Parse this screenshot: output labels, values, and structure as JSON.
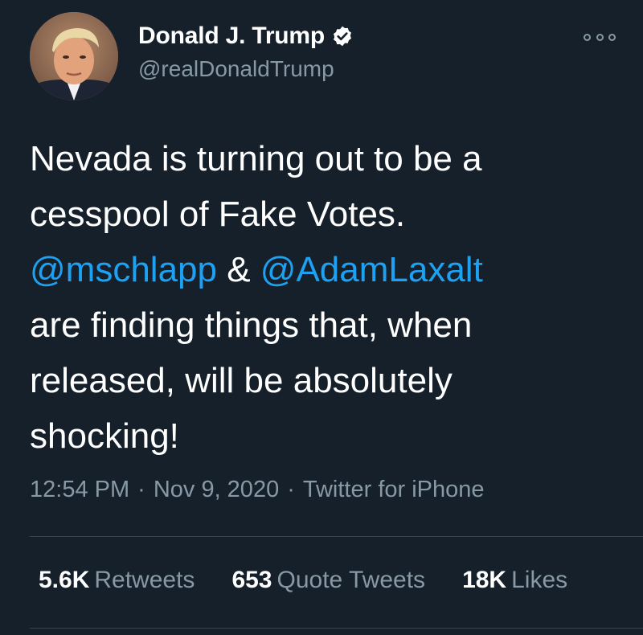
{
  "author": {
    "display_name": "Donald J. Trump",
    "handle": "@realDonaldTrump",
    "verified": true
  },
  "tweet": {
    "text_line1": "Nevada is turning out to be a",
    "text_line2": "cesspool of Fake Votes.",
    "mention1": "@mschlapp",
    "amp": " & ",
    "mention2": "@AdamLaxalt",
    "text_line4": "are finding things that, when",
    "text_line5": "released, will be absolutely",
    "text_line6": "shocking!"
  },
  "meta": {
    "time": "12:54 PM",
    "sep": "·",
    "date": "Nov 9, 2020",
    "source": "Twitter for iPhone"
  },
  "stats": {
    "retweets_count": "5.6K",
    "retweets_label": "Retweets",
    "quotes_count": "653",
    "quotes_label": "Quote Tweets",
    "likes_count": "18K",
    "likes_label": "Likes"
  },
  "colors": {
    "background": "#15202b",
    "link": "#1da1f2",
    "secondary_text": "#8899a6",
    "divider": "#38444d"
  }
}
